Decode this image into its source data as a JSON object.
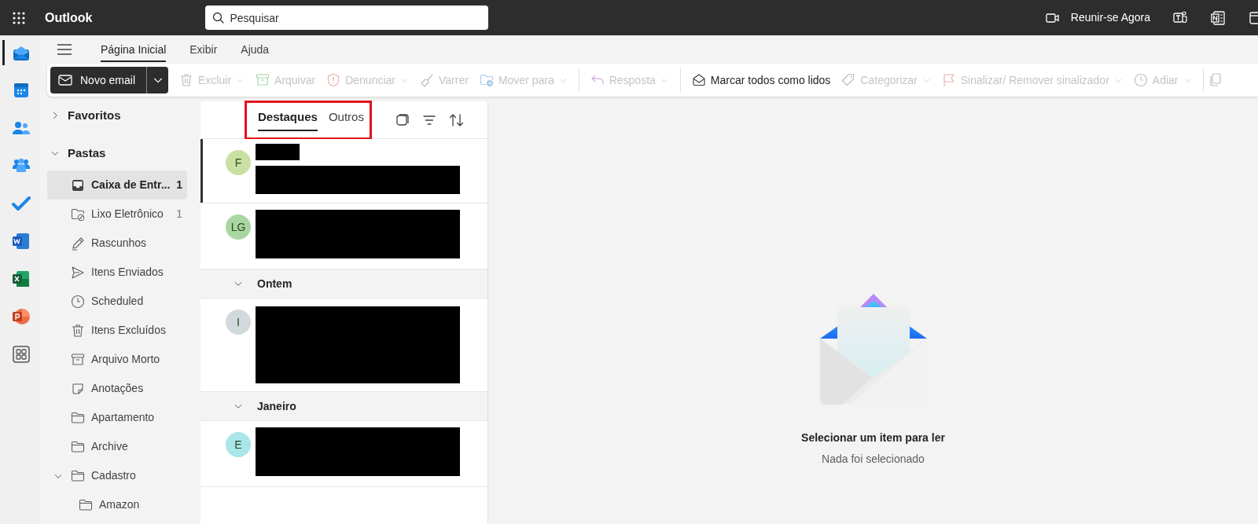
{
  "top_bar": {
    "app_name": "Outlook",
    "search": {
      "placeholder": "Pesquisar"
    },
    "meet_now": "Reunir-se Agora"
  },
  "app_rail": [
    {
      "kind": "mail",
      "selected": true
    },
    {
      "kind": "calendar",
      "selected": false
    },
    {
      "kind": "people",
      "selected": false
    },
    {
      "kind": "groups",
      "selected": false
    },
    {
      "kind": "todo",
      "selected": false
    },
    {
      "kind": "word",
      "selected": false
    },
    {
      "kind": "excel",
      "selected": false
    },
    {
      "kind": "powerpoint",
      "selected": false
    },
    {
      "kind": "apps",
      "selected": false
    }
  ],
  "ribbon_tabs": [
    {
      "label": "Página Inicial",
      "selected": true
    },
    {
      "label": "Exibir",
      "selected": false
    },
    {
      "label": "Ajuda",
      "selected": false
    }
  ],
  "toolbar": {
    "new_email": "Novo email",
    "groups": [
      {
        "actions": [
          {
            "kind": "delete",
            "label": "Excluir",
            "disabled": true,
            "dropdown": true
          },
          {
            "kind": "archive",
            "label": "Arquivar",
            "disabled": true,
            "dropdown": false
          },
          {
            "kind": "report",
            "label": "Denunciar",
            "disabled": true,
            "dropdown": true
          },
          {
            "kind": "sweep",
            "label": "Varrer",
            "disabled": true,
            "dropdown": false
          },
          {
            "kind": "move",
            "label": "Mover para",
            "disabled": true,
            "dropdown": true
          }
        ]
      },
      {
        "actions": [
          {
            "kind": "reply",
            "label": "Resposta",
            "disabled": true,
            "dropdown": true
          }
        ]
      },
      {
        "actions": [
          {
            "kind": "read",
            "label": "Marcar todos como lidos",
            "disabled": false,
            "dropdown": false
          },
          {
            "kind": "tag",
            "label": "Categorizar",
            "disabled": true,
            "dropdown": true
          },
          {
            "kind": "flag",
            "label": "Sinalizar/ Remover sinalizador",
            "disabled": true,
            "dropdown": true
          },
          {
            "kind": "clock",
            "label": "Adiar",
            "disabled": true,
            "dropdown": true
          }
        ]
      }
    ]
  },
  "folder_pane": {
    "favorites": {
      "label": "Favoritos",
      "expanded": false
    },
    "folders": {
      "label": "Pastas",
      "expanded": true,
      "items": [
        {
          "kind": "inbox",
          "label": "Caixa de Entr...",
          "count": "1",
          "selected": true
        },
        {
          "kind": "junk",
          "label": "Lixo Eletrônico",
          "count": "1",
          "selected": false
        },
        {
          "kind": "drafts",
          "label": "Rascunhos",
          "selected": false
        },
        {
          "kind": "sent",
          "label": "Itens Enviados",
          "selected": false
        },
        {
          "kind": "clock",
          "label": "Scheduled",
          "selected": false
        },
        {
          "kind": "deleted",
          "label": "Itens Excluídos",
          "selected": false
        },
        {
          "kind": "archive",
          "label": "Arquivo Morto",
          "selected": false
        },
        {
          "kind": "notes",
          "label": "Anotações",
          "selected": false
        },
        {
          "kind": "folder",
          "label": "Apartamento",
          "selected": false
        },
        {
          "kind": "folder",
          "label": "Archive",
          "selected": false
        },
        {
          "kind": "folder",
          "label": "Cadastro",
          "selected": false,
          "expanded": true,
          "children": [
            {
              "kind": "folder",
              "label": "Amazon",
              "selected": false
            }
          ]
        }
      ]
    }
  },
  "message_list": {
    "tabs": [
      {
        "label": "Destaques",
        "selected": true
      },
      {
        "label": "Outros",
        "selected": false
      }
    ],
    "sections": [
      {
        "items": [
          {
            "initials": "F",
            "color": "#c8e0a2",
            "selected": true,
            "kind": "split"
          },
          {
            "initials": "LG",
            "color": "#a9d6a2",
            "selected": false,
            "kind": "block"
          }
        ]
      },
      {
        "header": "Ontem",
        "expanded": true,
        "items": [
          {
            "initials": "I",
            "color": "#d2d9dc",
            "selected": false,
            "kind": "tall"
          }
        ]
      },
      {
        "header": "Janeiro",
        "expanded": true,
        "items": [
          {
            "initials": "E",
            "color": "#a8e6ea",
            "selected": false,
            "kind": "block"
          }
        ]
      }
    ]
  },
  "reading_pane": {
    "title": "Selecionar um item para ler",
    "subtitle": "Nada foi selecionado"
  }
}
